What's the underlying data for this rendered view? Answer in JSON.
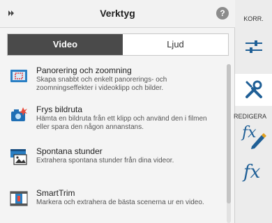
{
  "panel": {
    "title": "Verktyg",
    "help_glyph": "?",
    "collapse_icon": "double-chevron-right-icon"
  },
  "tabs": [
    {
      "label": "Video",
      "active": true
    },
    {
      "label": "Ljud",
      "active": false
    }
  ],
  "tools": [
    {
      "title": "Panorering och zoomning",
      "description": "Skapa snabbt och enkelt panorerings- och zoomningseffekter i videoklipp och bilder.",
      "icon": "pan-zoom-icon"
    },
    {
      "title": "Frys bildruta",
      "description": "Hämta en bildruta från ett klipp och använd den i filmen eller spara den någon annanstans.",
      "icon": "freeze-frame-camera-icon"
    },
    {
      "title": "Spontana stunder",
      "description": "Extrahera spontana stunder från dina videor.",
      "icon": "candid-moments-icon"
    },
    {
      "title": "SmartTrim",
      "description": "Markera och extrahera de bästa scenerna ur en video.",
      "icon": "smart-trim-icon"
    }
  ],
  "sidebar": {
    "label_top": "KORR.",
    "label_mid": "REDIGERA",
    "fx_text": "fx",
    "buttons": [
      "adjust-sliders-icon",
      "tools-icon",
      "applied-effects-icon",
      "effects-icon"
    ],
    "active_button": "tools-icon"
  },
  "colors": {
    "accent": "#1f5f96",
    "active_tab_bg": "#4a4a4a",
    "panel_bg": "#f4f4f4"
  }
}
